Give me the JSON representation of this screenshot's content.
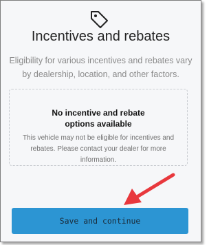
{
  "panel": {
    "icon": "tag-icon",
    "title": "Incentives and rebates",
    "subtitle": "Eligibility for various incentives and rebates vary by dealership, location, and other factors."
  },
  "empty_state": {
    "title": "No incentive and rebate options available",
    "message": "This vehicle may not be eligible for incentives and rebates. Please contact your dealer for more information."
  },
  "actions": {
    "save_label": "Save and continue"
  },
  "annotation": {
    "icon": "red-arrow-icon",
    "color": "#e8383d"
  },
  "colors": {
    "accent": "#2c95d3",
    "background": "#f6f7f9"
  }
}
